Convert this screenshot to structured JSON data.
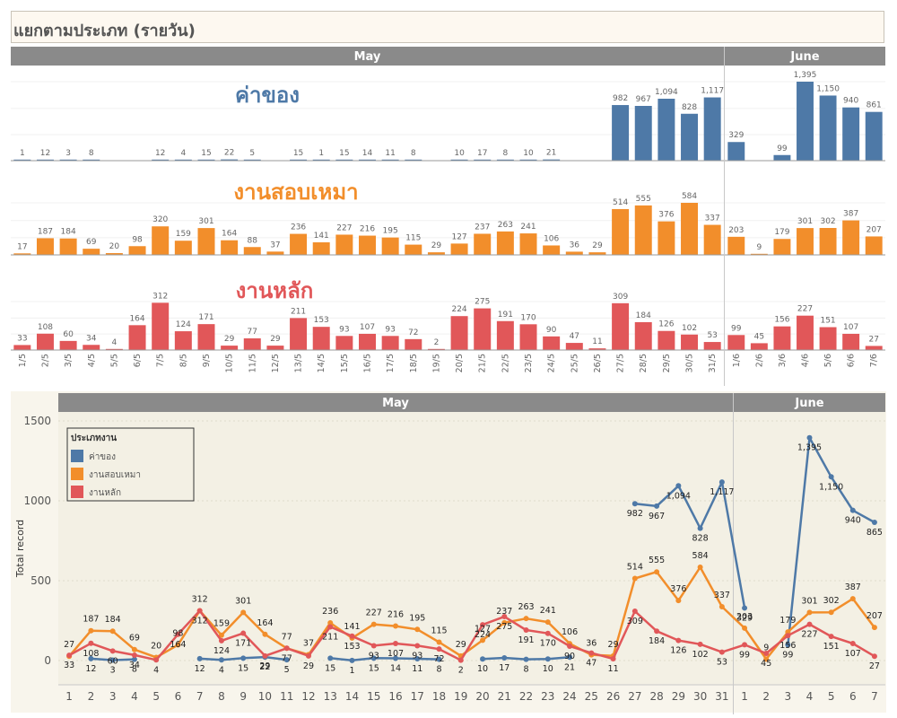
{
  "title": "แยกตามประเภท (รายวัน)",
  "months": [
    "May",
    "June"
  ],
  "chart_data": [
    {
      "type": "bar",
      "title": "",
      "categories": [
        "1/5",
        "2/5",
        "3/5",
        "4/5",
        "5/5",
        "6/5",
        "7/5",
        "8/5",
        "9/5",
        "10/5",
        "11/5",
        "12/5",
        "13/5",
        "14/5",
        "15/5",
        "16/5",
        "17/5",
        "18/5",
        "19/5",
        "20/5",
        "21/5",
        "22/5",
        "23/5",
        "24/5",
        "25/5",
        "26/5",
        "27/5",
        "28/5",
        "29/5",
        "30/5",
        "31/5",
        "1/6",
        "2/6",
        "3/6",
        "4/6",
        "5/6",
        "6/6",
        "7/6"
      ],
      "panels": [
        {
          "name": "ค่าของ",
          "color": "#4e79a7",
          "values": [
            1,
            12,
            3,
            8,
            null,
            null,
            12,
            4,
            15,
            22,
            5,
            null,
            15,
            1,
            15,
            14,
            11,
            8,
            null,
            10,
            17,
            8,
            10,
            21,
            null,
            null,
            982,
            967,
            1094,
            828,
            1117,
            329,
            null,
            99,
            1395,
            1150,
            940,
            861
          ]
        },
        {
          "name": "งานสอบเหมา",
          "color": "#f28e2b",
          "values": [
            17,
            187,
            184,
            69,
            20,
            98,
            320,
            159,
            301,
            164,
            88,
            37,
            236,
            141,
            227,
            216,
            195,
            115,
            29,
            127,
            237,
            263,
            241,
            106,
            36,
            29,
            514,
            555,
            376,
            584,
            337,
            203,
            9,
            179,
            301,
            302,
            387,
            207
          ]
        },
        {
          "name": "งานหลัก",
          "color": "#e15759",
          "values": [
            33,
            108,
            60,
            34,
            4,
            164,
            312,
            124,
            171,
            29,
            77,
            29,
            211,
            153,
            93,
            107,
            93,
            72,
            2,
            224,
            275,
            191,
            170,
            90,
            47,
            11,
            309,
            184,
            126,
            102,
            53,
            99,
            45,
            156,
            227,
            151,
            107,
            27
          ]
        }
      ]
    },
    {
      "type": "line",
      "ylabel": "Total record",
      "ylim": [
        0,
        1600
      ],
      "yticks": [
        0,
        500,
        1000,
        1500
      ],
      "legend_title": "ประเภทงาน",
      "legend_position": "top-left",
      "xticks": [
        "1",
        "2",
        "3",
        "4",
        "5",
        "6",
        "7",
        "8",
        "9",
        "10",
        "11",
        "12",
        "13",
        "14",
        "15",
        "16",
        "17",
        "18",
        "19",
        "20",
        "21",
        "22",
        "23",
        "24",
        "25",
        "26",
        "27",
        "28",
        "29",
        "30",
        "31",
        "1",
        "2",
        "3",
        "4",
        "5",
        "6",
        "7"
      ],
      "series": [
        {
          "name": "ค่าของ",
          "color": "#4e79a7",
          "values": [
            null,
            12,
            3,
            8,
            null,
            null,
            12,
            4,
            15,
            22,
            5,
            null,
            15,
            1,
            15,
            14,
            11,
            8,
            null,
            10,
            17,
            8,
            10,
            21,
            null,
            null,
            982,
            967,
            1094,
            828,
            1117,
            329,
            null,
            99,
            1395,
            1150,
            940,
            865
          ]
        },
        {
          "name": "งานสอบเหมา",
          "color": "#f28e2b",
          "values": [
            27,
            187,
            184,
            69,
            20,
            98,
            312,
            159,
            301,
            164,
            77,
            37,
            236,
            141,
            227,
            216,
            195,
            115,
            29,
            127,
            237,
            263,
            241,
            106,
            36,
            29,
            514,
            555,
            376,
            584,
            337,
            203,
            9,
            179,
            301,
            302,
            387,
            207
          ]
        },
        {
          "name": "งานหลัก",
          "color": "#e15759",
          "values": [
            33,
            108,
            60,
            34,
            4,
            164,
            312,
            124,
            171,
            29,
            77,
            29,
            211,
            153,
            93,
            107,
            93,
            72,
            2,
            224,
            275,
            191,
            170,
            90,
            47,
            11,
            309,
            184,
            126,
            102,
            53,
            99,
            45,
            156,
            227,
            151,
            107,
            27
          ]
        }
      ]
    }
  ]
}
